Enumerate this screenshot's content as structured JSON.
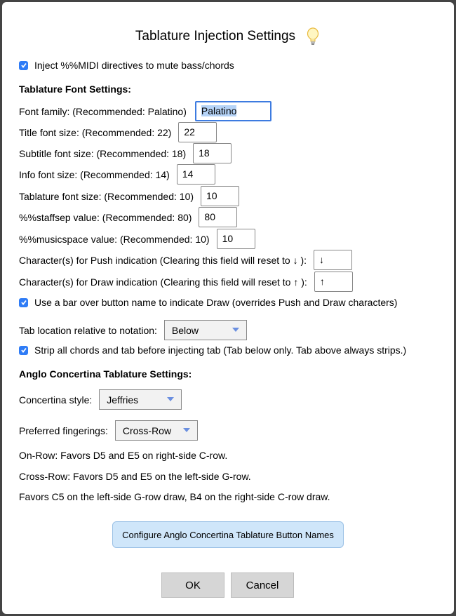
{
  "dialog": {
    "title": "Tablature Injection Settings",
    "inject_midi_label": "Inject %%MIDI directives to mute bass/chords",
    "font_section_title": "Tablature Font Settings:",
    "font_family_label": "Font family: (Recommended: Palatino)",
    "font_family_value": "Palatino",
    "title_font_label": "Title font size: (Recommended: 22)",
    "title_font_value": "22",
    "subtitle_font_label": "Subtitle font size: (Recommended: 18)",
    "subtitle_font_value": "18",
    "info_font_label": "Info font size: (Recommended: 14)",
    "info_font_value": "14",
    "tab_font_label": "Tablature font size: (Recommended: 10)",
    "tab_font_value": "10",
    "staffsep_label": "%%staffsep value: (Recommended: 80)",
    "staffsep_value": "80",
    "musicspace_label": "%%musicspace value: (Recommended: 10)",
    "musicspace_value": "10",
    "push_label": "Character(s) for Push indication (Clearing this field will reset to ↓ ):",
    "push_value": "↓",
    "draw_label": "Character(s) for Draw indication (Clearing this field will reset to ↑ ):",
    "draw_value": "↑",
    "bar_over_label": "Use a bar over button name to indicate Draw (overrides Push and Draw characters)",
    "tab_location_label": "Tab location relative to notation:",
    "tab_location_value": "Below",
    "strip_label": "Strip all chords and tab before injecting tab (Tab below only. Tab above always strips.)",
    "anglo_section_title": "Anglo Concertina Tablature Settings:",
    "concertina_style_label": "Concertina style:",
    "concertina_style_value": "Jeffries",
    "fingering_label": "Preferred fingerings:",
    "fingering_value": "Cross-Row",
    "note_on_row": "On-Row: Favors D5 and E5 on right-side C-row.",
    "note_cross_row": "Cross-Row: Favors D5 and E5 on the left-side G-row.",
    "note_favors": "Favors C5 on the left-side G-row draw, B4 on the right-side C-row draw.",
    "configure_button": "Configure Anglo Concertina Tablature Button Names",
    "ok_button": "OK",
    "cancel_button": "Cancel"
  },
  "colors": {
    "checkbox": "#2f7cf6",
    "focus": "#3d7be0",
    "primary_button": "#cfe6fa"
  },
  "icons": {
    "title_icon": "lightbulb-icon"
  }
}
